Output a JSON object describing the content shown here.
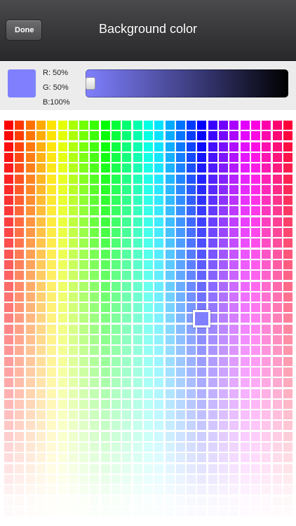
{
  "nav": {
    "done_label": "Done",
    "title": "Background color"
  },
  "selected": {
    "color": "#8080ff",
    "r_label": "R: 50%",
    "g_label": "G: 50%",
    "b_label": "B:100%",
    "brightness": 0.0
  },
  "grid": {
    "columns": 27,
    "rows": 37
  },
  "selected_cell": {
    "column": 18,
    "row": 18
  }
}
